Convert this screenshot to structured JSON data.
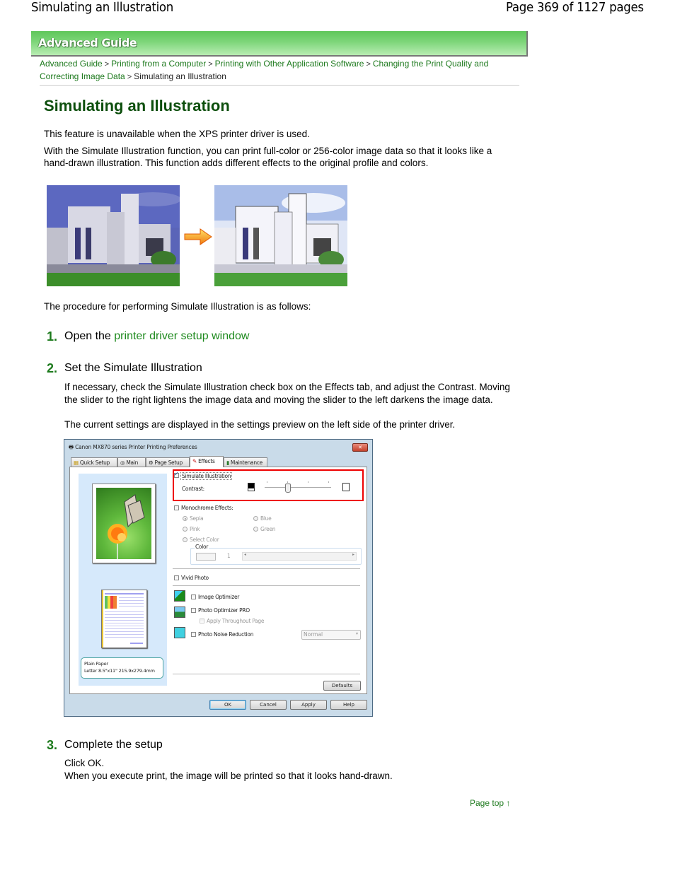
{
  "header": {
    "title": "Simulating an Illustration",
    "page_indicator": "Page 369 of 1127 pages"
  },
  "banner": {
    "label": "Advanced Guide"
  },
  "breadcrumb": {
    "items": [
      {
        "label": "Advanced Guide",
        "link": true
      },
      {
        "label": "Printing from a Computer",
        "link": true
      },
      {
        "label": "Printing with Other Application Software",
        "link": true
      },
      {
        "label": "Changing the Print Quality and Correcting Image Data",
        "link": true
      },
      {
        "label": "Simulating an Illustration",
        "link": false
      }
    ],
    "separator": ">"
  },
  "page_title": "Simulating an Illustration",
  "intro": {
    "note": "This feature is unavailable when the XPS printer driver is used.",
    "description": "With the Simulate Illustration function, you can print full-color or 256-color image data so that it looks like a hand-drawn illustration. This function adds different effects to the original profile and colors."
  },
  "illustration": {
    "before_alt": "Original photo of building",
    "after_alt": "Illustration-style photo of building",
    "arrow_icon": "right-arrow-icon"
  },
  "procedure_intro": "The procedure for performing Simulate Illustration is as follows:",
  "steps": [
    {
      "number": "1.",
      "title_prefix": "Open the ",
      "title_link": "printer driver setup window"
    },
    {
      "number": "2.",
      "title": "Set the Simulate Illustration",
      "body_1": "If necessary, check the Simulate Illustration check box on the Effects tab, and adjust the Contrast. Moving the slider to the right lightens the image data and moving the slider to the left darkens the image data.",
      "body_2": "The current settings are displayed in the settings preview on the left side of the printer driver."
    },
    {
      "number": "3.",
      "title": "Complete the setup",
      "body_1": "Click OK.",
      "body_2": "When you execute print, the image will be printed so that it looks hand-drawn."
    }
  ],
  "dialog": {
    "title": "Canon MX870 series Printer Printing Preferences",
    "close_label": "✕",
    "tabs": [
      {
        "label": "Quick Setup",
        "active": false
      },
      {
        "label": "Main",
        "active": false
      },
      {
        "label": "Page Setup",
        "active": false
      },
      {
        "label": "Effects",
        "active": true
      },
      {
        "label": "Maintenance",
        "active": false
      }
    ],
    "simulate_illustration": {
      "label": "Simulate Illustration",
      "checked": true
    },
    "contrast": {
      "label": "Contrast:",
      "value_fraction": 0.33
    },
    "monochrome_effects": {
      "label": "Monochrome Effects:",
      "checked": false
    },
    "monochrome_options": [
      {
        "label": "Sepia",
        "selected": true
      },
      {
        "label": "Blue",
        "selected": false
      },
      {
        "label": "Pink",
        "selected": false
      },
      {
        "label": "Green",
        "selected": false
      },
      {
        "label": "Select Color",
        "selected": false
      }
    ],
    "color_group": {
      "label": "Color",
      "value": "1"
    },
    "vivid_photo": {
      "label": "Vivid Photo",
      "checked": false
    },
    "image_optimizer": {
      "label": "Image Optimizer",
      "checked": false
    },
    "photo_optimizer_pro": {
      "label": "Photo Optimizer PRO",
      "checked": false
    },
    "apply_throughout_page": {
      "label": "Apply Throughout Page",
      "checked": false
    },
    "photo_noise_reduction": {
      "label": "Photo Noise Reduction",
      "checked": false
    },
    "noise_level": {
      "value": "Normal"
    },
    "preview_paper": {
      "line1": "Plain Paper",
      "line2": "Letter 8.5\"x11\" 215.9x279.4mm"
    },
    "buttons": {
      "defaults": "Defaults",
      "ok": "OK",
      "cancel": "Cancel",
      "apply": "Apply",
      "help": "Help"
    }
  },
  "footer": {
    "page_top": "Page top"
  },
  "colors": {
    "accent_green": "#1e7a1e",
    "title_green": "#0d4f0d",
    "highlight_red": "#e00000"
  }
}
